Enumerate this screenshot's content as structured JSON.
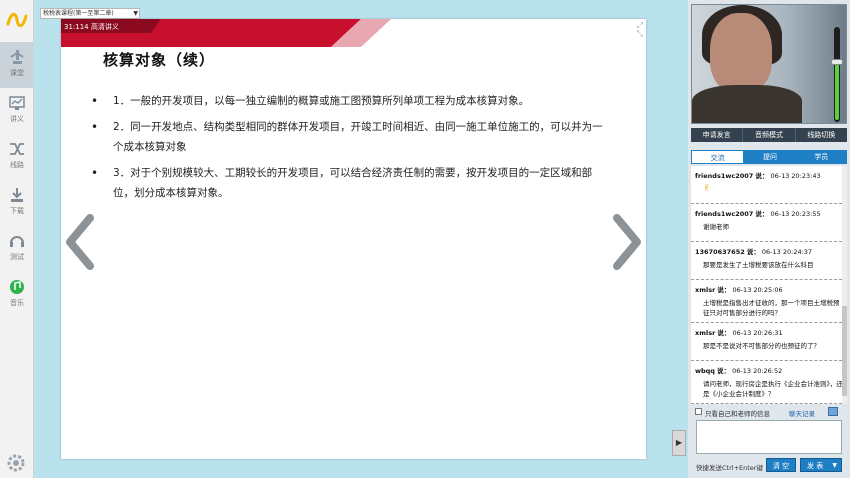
{
  "nav": {
    "items": [
      {
        "label": "课堂",
        "icon": "classroom-icon"
      },
      {
        "label": "讲义",
        "icon": "handout-icon"
      },
      {
        "label": "线路",
        "icon": "route-icon"
      },
      {
        "label": "下载",
        "icon": "download-icon"
      },
      {
        "label": "测试",
        "icon": "headset-icon"
      },
      {
        "label": "音乐",
        "icon": "music-icon"
      }
    ]
  },
  "course_select": {
    "value": "税税表课程(第一至第二章)"
  },
  "slide": {
    "tag": "31:114 高清讲义",
    "title": "核算对象（续）",
    "bullets": [
      "1．一般的开发项目，以每一独立编制的概算或施工图预算所列单项工程为成本核算对象。",
      "2．同一开发地点、结构类型相同的群体开发项目，开竣工时间相近、由同一施工单位施工的，可以并为一个成本核算对象",
      "3．对于个别规模较大、工期较长的开发项目，可以结合经济责任制的需要，按开发项目的一定区域和部位，划分成本核算对象。"
    ]
  },
  "video": {
    "controls": [
      "申请发言",
      "音频模式",
      "线路切换"
    ],
    "volume_percent": 65
  },
  "chat": {
    "tabs": [
      "交流",
      "提问",
      "学员"
    ],
    "active_tab": 0,
    "messages": [
      {
        "user": "friends1wc2007",
        "said": "说：",
        "time": "06-13 20:23:43",
        "text": "✌"
      },
      {
        "user": "friends1wc2007",
        "said": "说：",
        "time": "06-13 20:23:55",
        "text": "谢谢老师"
      },
      {
        "user": "13670637652",
        "said": "说：",
        "time": "06-13 20:24:37",
        "text": "那要是发生了土增税要该放在什么科目"
      },
      {
        "user": "xmlsr",
        "said": "说：",
        "time": "06-13 20:25:06",
        "text": "土增税是指售出才征收的，那一个项目土增税预征只对可售部分进行的吗？"
      },
      {
        "user": "xmlsr",
        "said": "说：",
        "time": "06-13 20:26:31",
        "text": "那是不是说对不可售部分的也预征的了？"
      },
      {
        "user": "wbqq",
        "said": "说：",
        "time": "06-13 20:26:52",
        "text": "请问老师，现行房企是执行《企业会计准则》，还是《小企业会计制度》？"
      }
    ],
    "only_me_label": "只看自己和老师的信息",
    "history_label": "聊天记录",
    "input_value": "",
    "hint": "快捷发送Ctrl+Enter键",
    "clear_label": "清 空",
    "send_label": "发 表"
  }
}
